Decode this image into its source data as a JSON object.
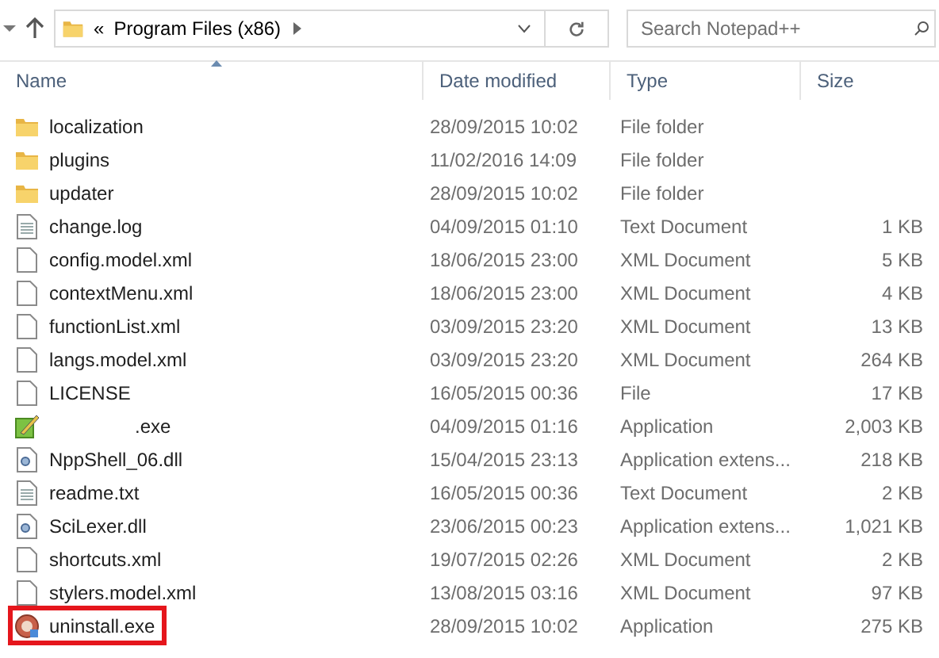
{
  "address_bar": {
    "path": [
      "«",
      "Program Files (x86)"
    ]
  },
  "search": {
    "placeholder": "Search Notepad++"
  },
  "columns": [
    {
      "label": "Name",
      "sorted": true
    },
    {
      "label": "Date modified",
      "sorted": false
    },
    {
      "label": "Type",
      "sorted": false
    },
    {
      "label": "Size",
      "sorted": false
    }
  ],
  "rows": [
    {
      "kind": "folder",
      "name": "localization",
      "date": "28/09/2015 10:02",
      "type": "File folder",
      "size": "",
      "highlighted": false
    },
    {
      "kind": "folder",
      "name": "plugins",
      "date": "11/02/2016 14:09",
      "type": "File folder",
      "size": "",
      "highlighted": false
    },
    {
      "kind": "folder",
      "name": "updater",
      "date": "28/09/2015 10:02",
      "type": "File folder",
      "size": "",
      "highlighted": false
    },
    {
      "kind": "text",
      "name": "change.log",
      "date": "04/09/2015 01:10",
      "type": "Text Document",
      "size": "1 KB",
      "highlighted": false
    },
    {
      "kind": "file",
      "name": "config.model.xml",
      "date": "18/06/2015 23:00",
      "type": "XML Document",
      "size": "5 KB",
      "highlighted": false
    },
    {
      "kind": "file",
      "name": "contextMenu.xml",
      "date": "18/06/2015 23:00",
      "type": "XML Document",
      "size": "4 KB",
      "highlighted": false
    },
    {
      "kind": "file",
      "name": "functionList.xml",
      "date": "03/09/2015 23:20",
      "type": "XML Document",
      "size": "13 KB",
      "highlighted": false
    },
    {
      "kind": "file",
      "name": "langs.model.xml",
      "date": "03/09/2015 23:20",
      "type": "XML Document",
      "size": "264 KB",
      "highlighted": false
    },
    {
      "kind": "file",
      "name": "LICENSE",
      "date": "16/05/2015 00:36",
      "type": "File",
      "size": "17 KB",
      "highlighted": false
    },
    {
      "kind": "app",
      "name": ".exe",
      "date": "04/09/2015 01:16",
      "type": "Application",
      "size": "2,003 KB",
      "highlighted": false,
      "redacted": true
    },
    {
      "kind": "dll",
      "name": "NppShell_06.dll",
      "date": "15/04/2015 23:13",
      "type": "Application extens...",
      "size": "218 KB",
      "highlighted": false
    },
    {
      "kind": "text",
      "name": "readme.txt",
      "date": "16/05/2015 00:36",
      "type": "Text Document",
      "size": "2 KB",
      "highlighted": false
    },
    {
      "kind": "dll",
      "name": "SciLexer.dll",
      "date": "23/06/2015 00:23",
      "type": "Application extens...",
      "size": "1,021 KB",
      "highlighted": false
    },
    {
      "kind": "file",
      "name": "shortcuts.xml",
      "date": "19/07/2015 02:26",
      "type": "XML Document",
      "size": "2 KB",
      "highlighted": false
    },
    {
      "kind": "file",
      "name": "stylers.model.xml",
      "date": "13/08/2015 03:16",
      "type": "XML Document",
      "size": "97 KB",
      "highlighted": false
    },
    {
      "kind": "installer",
      "name": "uninstall.exe",
      "date": "28/09/2015 10:02",
      "type": "Application",
      "size": "275 KB",
      "highlighted": true
    }
  ]
}
